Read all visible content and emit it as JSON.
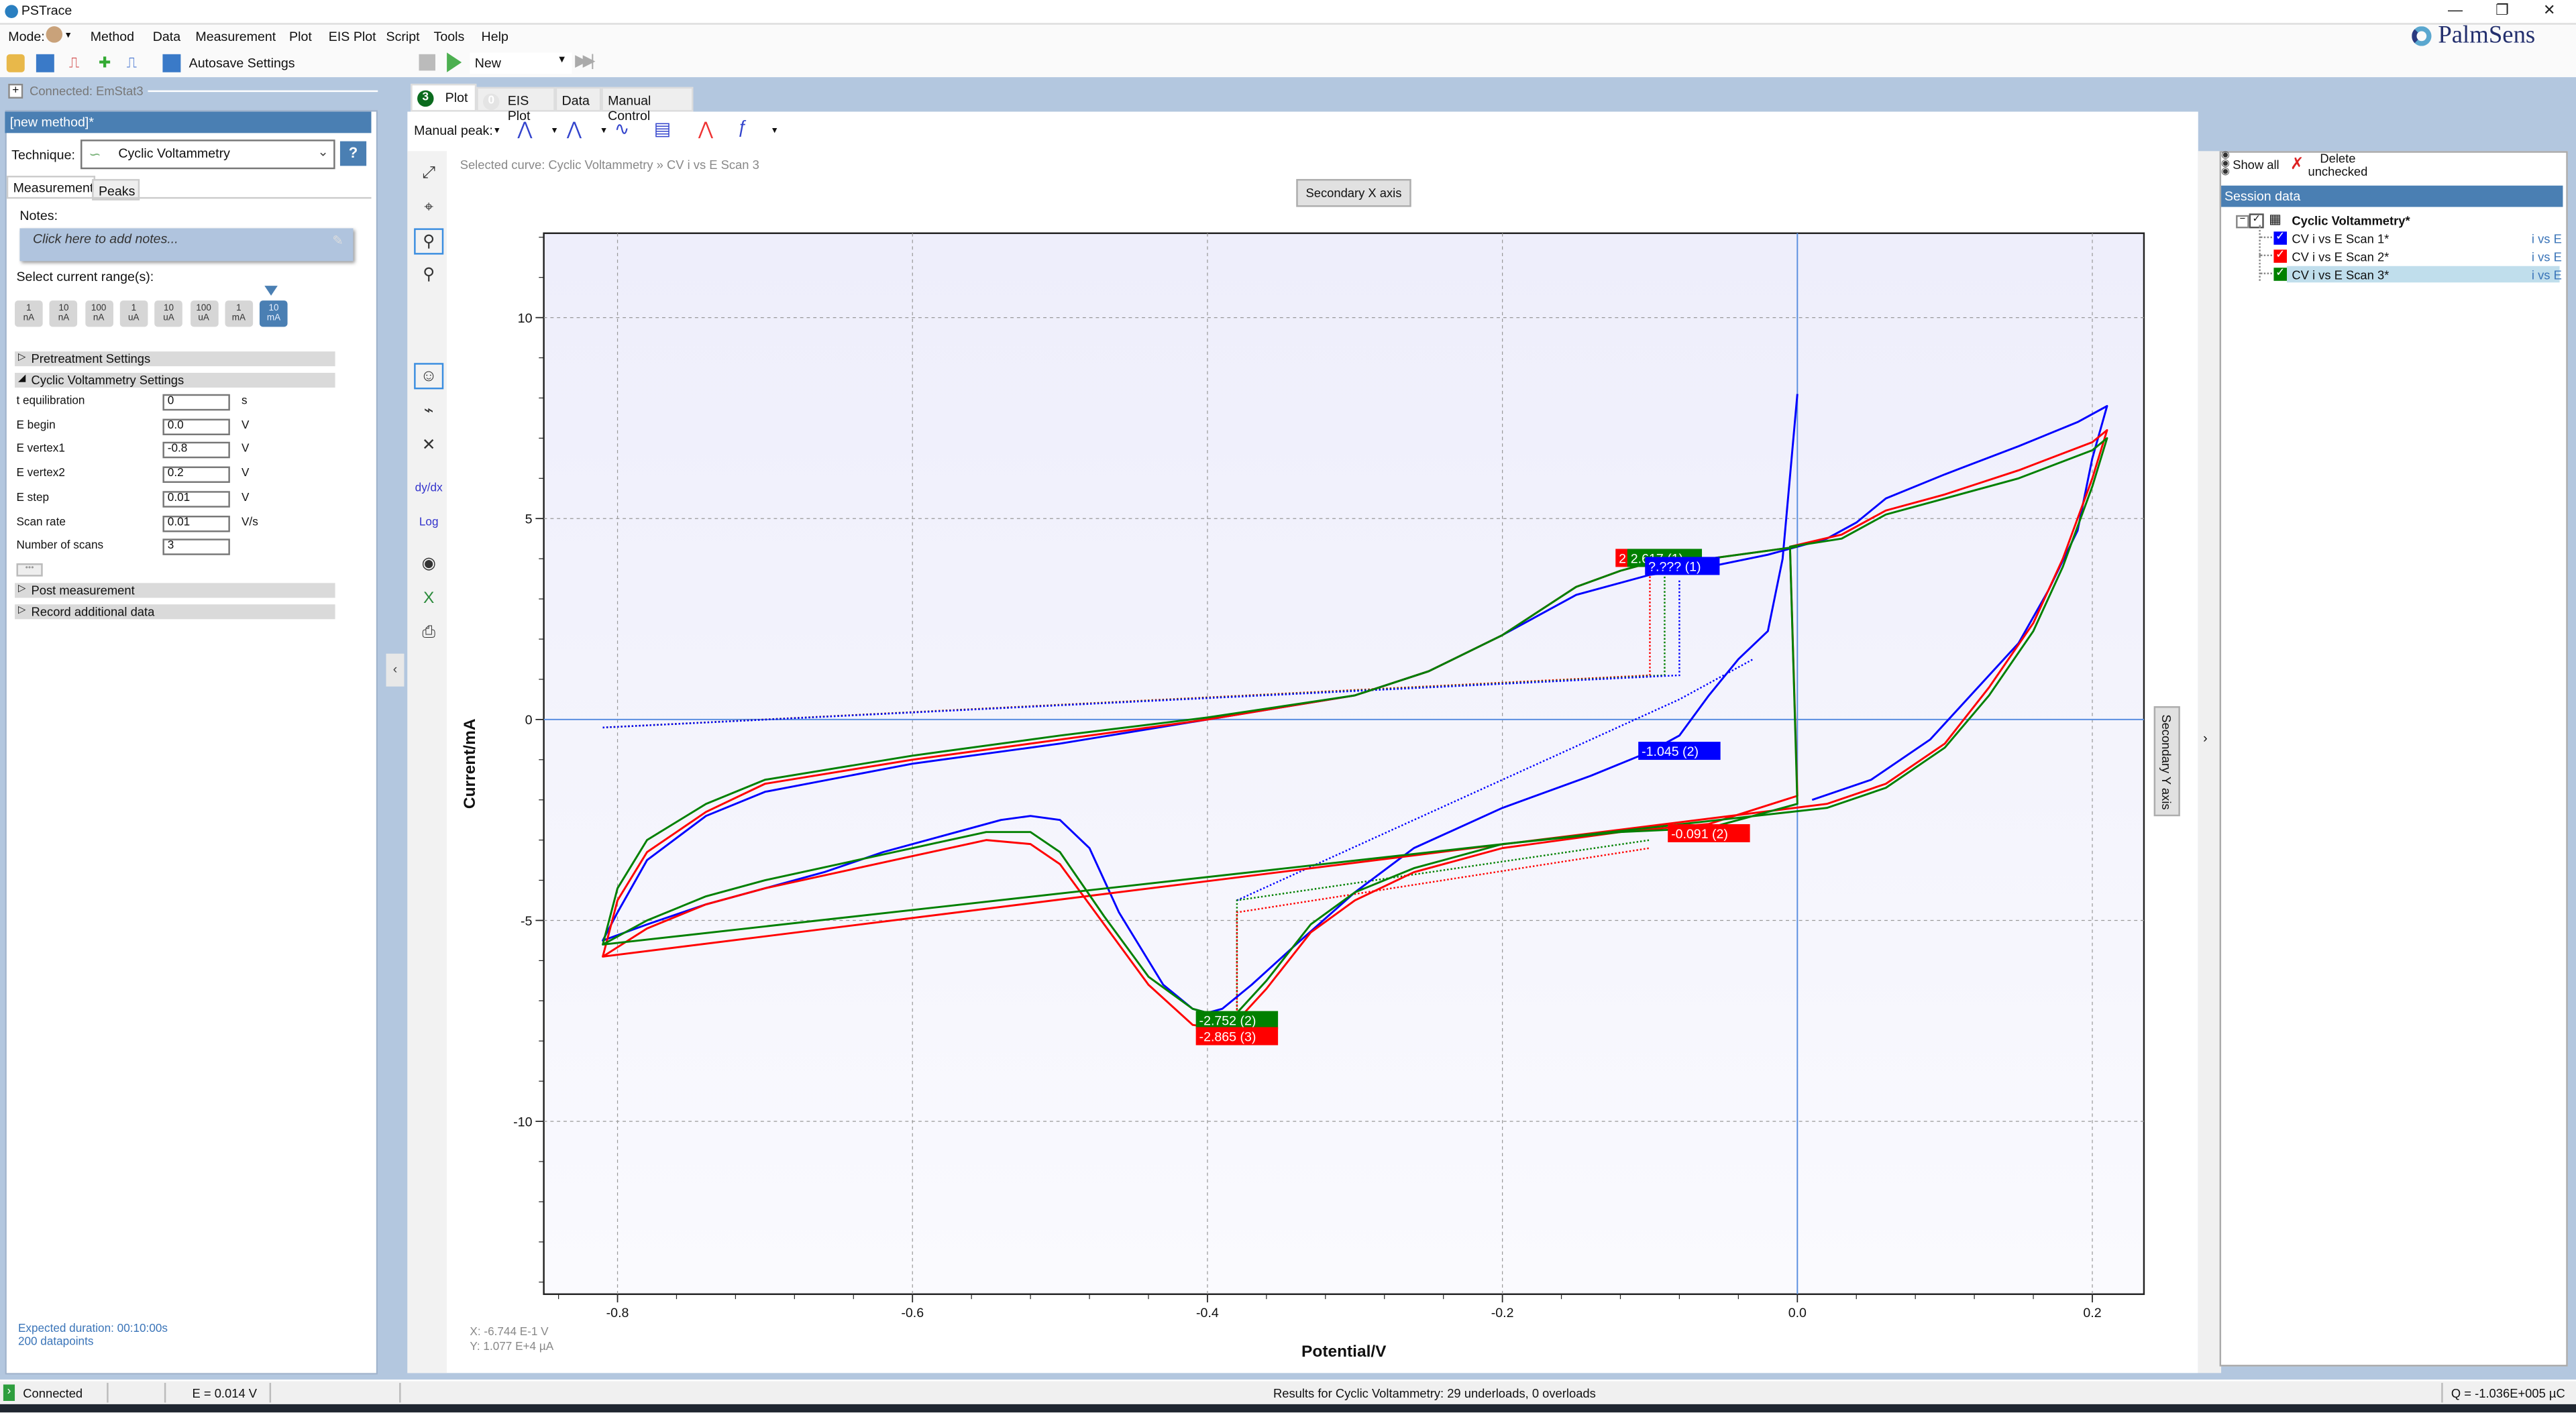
{
  "window": {
    "title": "PSTrace",
    "controls": [
      "minimize-icon",
      "restore-icon",
      "close-icon"
    ]
  },
  "brand": "PalmSens",
  "menu": {
    "mode_label": "Mode:",
    "items": [
      "Method",
      "Data",
      "Measurement",
      "Plot",
      "EIS Plot",
      "Script",
      "Tools",
      "Help"
    ]
  },
  "toolbar": {
    "autosave_label": "Autosave Settings",
    "run_selection": "New"
  },
  "connection": {
    "label": "Connected: EmStat3"
  },
  "method": {
    "title": "[new method]*",
    "technique_label": "Technique:",
    "technique_value": "Cyclic Voltammetry",
    "help_label": "?",
    "tabs": [
      "Measurement",
      "Peaks"
    ],
    "notes_label": "Notes:",
    "notes_placeholder": "Click here to add notes...",
    "current_range_label": "Select current range(s):",
    "current_ranges": [
      {
        "value": "1",
        "unit": "nA",
        "selected": false
      },
      {
        "value": "10",
        "unit": "nA",
        "selected": false
      },
      {
        "value": "100",
        "unit": "nA",
        "selected": false
      },
      {
        "value": "1",
        "unit": "uA",
        "selected": false
      },
      {
        "value": "10",
        "unit": "uA",
        "selected": false
      },
      {
        "value": "100",
        "unit": "uA",
        "selected": false
      },
      {
        "value": "1",
        "unit": "mA",
        "selected": false
      },
      {
        "value": "10",
        "unit": "mA",
        "selected": true
      }
    ],
    "sections": {
      "pretreatment": "Pretreatment Settings",
      "cv": "Cyclic Voltammetry Settings",
      "post": "Post measurement",
      "record": "Record additional data"
    },
    "params": [
      {
        "label": "t equilibration",
        "value": "0",
        "unit": "s"
      },
      {
        "label": "E begin",
        "value": "0.0",
        "unit": "V"
      },
      {
        "label": "E vertex1",
        "value": "-0.8",
        "unit": "V"
      },
      {
        "label": "E vertex2",
        "value": "0.2",
        "unit": "V"
      },
      {
        "label": "E step",
        "value": "0.01",
        "unit": "V"
      },
      {
        "label": "Scan rate",
        "value": "0.01",
        "unit": "V/s"
      },
      {
        "label": "Number of scans",
        "value": "3",
        "unit": ""
      }
    ],
    "more_label": "•••",
    "expected_duration": "Expected duration: 00:10:00s",
    "datapoints": "200 datapoints"
  },
  "center": {
    "tabs": [
      {
        "label": "Plot",
        "badge": "3",
        "active": true
      },
      {
        "label": "EIS Plot",
        "badge": "0",
        "active": false
      },
      {
        "label": "Data",
        "active": false
      },
      {
        "label": "Manual Control",
        "active": false
      }
    ],
    "manual_peak_label": "Manual peak:",
    "selected_curve": "Selected curve: Cyclic Voltammetry » CV i vs E Scan 3",
    "secondary_x_label": "Secondary X axis",
    "secondary_y_label": "Secondary Y axis",
    "cursor_x": "X: -6.744 E-1 V",
    "cursor_y": "Y: 1.077 E+4 µA"
  },
  "session": {
    "show_all": "Show all",
    "delete_unchecked": "Delete unchecked",
    "header": "Session data",
    "group": "Cyclic Voltammetry*",
    "items": [
      {
        "label": "CV i vs E Scan 1*",
        "type": "i vs E",
        "color": "#0000ff",
        "checked": true,
        "selected": false
      },
      {
        "label": "CV i vs E Scan 2*",
        "type": "i vs E",
        "color": "#ff0000",
        "checked": true,
        "selected": false
      },
      {
        "label": "CV i vs E Scan 3*",
        "type": "i vs E",
        "color": "#008000",
        "checked": true,
        "selected": true
      }
    ]
  },
  "status": {
    "connected": "Connected",
    "potential": "E = 0.014 V",
    "results": "Results for Cyclic Voltammetry: 29 underloads, 0 overloads",
    "charge": "Q = -1.036E+005 µC"
  },
  "chart_data": {
    "type": "line",
    "title": "",
    "xlabel": "Potential/V",
    "ylabel": "Current/mA",
    "xlim": [
      -0.85,
      0.235
    ],
    "ylim": [
      -14.3,
      12.1
    ],
    "xticks": [
      -0.8,
      -0.6,
      -0.4,
      -0.2,
      0.0,
      0.2
    ],
    "xtick_labels": [
      "-0.8",
      "-0.6",
      "-0.4",
      "-0.2",
      "0.0",
      "0.2"
    ],
    "yticks": [
      10,
      5,
      0,
      -5,
      -10
    ],
    "ytick_labels": [
      "10",
      "5",
      "0",
      "-5",
      "-10"
    ],
    "grid": true,
    "series": [
      {
        "name": "CV i vs E Scan 1",
        "color": "#0000ff",
        "x": [
          0.0,
          0.0,
          -0.01,
          -0.02,
          -0.04,
          -0.06,
          -0.08,
          -0.1,
          -0.14,
          -0.2,
          -0.26,
          -0.3,
          -0.34,
          -0.37,
          -0.39,
          -0.4,
          -0.41,
          -0.43,
          -0.46,
          -0.48,
          -0.5,
          -0.52,
          -0.54,
          -0.58,
          -0.62,
          -0.66,
          -0.7,
          -0.74,
          -0.78,
          -0.81,
          -0.8,
          -0.78,
          -0.74,
          -0.7,
          -0.6,
          -0.5,
          -0.4,
          -0.3,
          -0.25,
          -0.2,
          -0.15,
          -0.12,
          -0.1,
          -0.06,
          -0.02,
          0.0,
          0.02,
          0.04,
          0.06,
          0.1,
          0.15,
          0.19,
          0.21,
          0.2,
          0.19,
          0.17,
          0.15,
          0.12,
          0.09,
          0.05,
          0.01
        ],
        "y": [
          8.1,
          8.1,
          4.0,
          2.2,
          1.5,
          0.6,
          -0.4,
          -0.8,
          -1.4,
          -2.2,
          -3.2,
          -4.3,
          -5.6,
          -6.6,
          -7.2,
          -7.3,
          -7.2,
          -6.6,
          -4.8,
          -3.2,
          -2.5,
          -2.4,
          -2.5,
          -2.9,
          -3.3,
          -3.8,
          -4.2,
          -4.6,
          -5.1,
          -5.5,
          -4.8,
          -3.5,
          -2.4,
          -1.8,
          -1.1,
          -0.6,
          0.0,
          0.6,
          1.2,
          2.1,
          3.1,
          3.4,
          3.6,
          3.8,
          4.1,
          4.3,
          4.5,
          4.9,
          5.5,
          6.1,
          6.8,
          7.4,
          7.8,
          6.5,
          4.7,
          3.2,
          1.9,
          0.7,
          -0.5,
          -1.5,
          -2.0
        ]
      },
      {
        "name": "CV i vs E Scan 2",
        "color": "#ff0000",
        "x": [
          -0.81,
          -0.78,
          -0.74,
          -0.7,
          -0.6,
          -0.55,
          -0.52,
          -0.5,
          -0.47,
          -0.44,
          -0.41,
          -0.39,
          -0.38,
          -0.36,
          -0.33,
          -0.3,
          -0.26,
          -0.2,
          -0.12,
          -0.06,
          0.0,
          -0.005,
          0.03,
          0.06,
          0.1,
          0.15,
          0.2,
          0.21,
          0.2,
          0.18,
          0.16,
          0.13,
          0.1,
          0.06,
          0.02,
          -0.81,
          -0.8,
          -0.78,
          -0.74,
          -0.7,
          -0.6,
          -0.5,
          -0.4,
          -0.3,
          -0.25,
          -0.2,
          -0.15,
          -0.12,
          -0.1,
          -0.06,
          -0.02,
          0.0
        ],
        "y": [
          -5.9,
          -5.2,
          -4.6,
          -4.2,
          -3.4,
          -3.0,
          -3.1,
          -3.6,
          -5.1,
          -6.6,
          -7.6,
          -7.7,
          -7.5,
          -6.7,
          -5.3,
          -4.5,
          -3.8,
          -3.2,
          -2.8,
          -2.6,
          -1.9,
          4.3,
          4.6,
          5.2,
          5.6,
          6.2,
          6.9,
          7.2,
          6.0,
          4.0,
          2.4,
          0.8,
          -0.6,
          -1.6,
          -2.1,
          -5.9,
          -4.5,
          -3.3,
          -2.3,
          -1.6,
          -1.0,
          -0.5,
          0.0,
          0.6,
          1.2,
          2.1,
          3.3,
          3.7,
          3.9,
          4.0,
          4.2,
          4.3
        ]
      },
      {
        "name": "CV i vs E Scan 3",
        "color": "#008000",
        "x": [
          -0.81,
          -0.78,
          -0.74,
          -0.7,
          -0.6,
          -0.55,
          -0.52,
          -0.5,
          -0.47,
          -0.44,
          -0.41,
          -0.39,
          -0.38,
          -0.36,
          -0.33,
          -0.3,
          -0.26,
          -0.2,
          -0.12,
          -0.06,
          0.0,
          -0.005,
          0.03,
          0.06,
          0.1,
          0.15,
          0.2,
          0.21,
          0.2,
          0.18,
          0.16,
          0.13,
          0.1,
          0.06,
          0.02,
          -0.81,
          -0.8,
          -0.78,
          -0.74,
          -0.7,
          -0.6,
          -0.5,
          -0.4,
          -0.3,
          -0.25,
          -0.2,
          -0.15,
          -0.12,
          -0.1,
          -0.06,
          -0.02,
          0.0
        ],
        "y": [
          -5.6,
          -5.0,
          -4.4,
          -4.0,
          -3.2,
          -2.8,
          -2.8,
          -3.3,
          -4.9,
          -6.4,
          -7.2,
          -7.4,
          -7.3,
          -6.5,
          -5.1,
          -4.3,
          -3.7,
          -3.1,
          -2.8,
          -2.7,
          -2.1,
          4.3,
          4.5,
          5.1,
          5.5,
          6.0,
          6.7,
          7.0,
          5.8,
          3.8,
          2.2,
          0.6,
          -0.7,
          -1.7,
          -2.2,
          -5.6,
          -4.2,
          -3.0,
          -2.1,
          -1.5,
          -0.9,
          -0.4,
          0.05,
          0.6,
          1.2,
          2.1,
          3.3,
          3.7,
          3.9,
          4.0,
          4.2,
          4.3
        ]
      }
    ],
    "peaks": [
      {
        "label": "2.6?? (1)",
        "color": "#ff0000",
        "x": -0.098,
        "y": 4.0
      },
      {
        "label": "2.617 (1)",
        "color": "#008000",
        "x": -0.09,
        "y": 4.0
      },
      {
        "label": "?.??? (1)",
        "color": "#0000ff",
        "x": -0.078,
        "y": 3.8
      },
      {
        "label": "-1.045 (2)",
        "color": "#0000ff",
        "x": -0.08,
        "y": -0.8
      },
      {
        "label": "-0.091 (2)",
        "color": "#ff0000",
        "x": -0.06,
        "y": -2.85
      },
      {
        "label": "-2.752 (2)",
        "color": "#008000",
        "x": -0.38,
        "y": -7.5
      },
      {
        "label": "-2.865 (3)",
        "color": "#ff0000",
        "x": -0.38,
        "y": -7.9
      }
    ],
    "baselines": [
      {
        "color": "#ff0000",
        "x": [
          -0.81,
          -0.1,
          -0.1
        ],
        "y": [
          -0.2,
          1.1,
          3.6
        ]
      },
      {
        "color": "#008000",
        "x": [
          -0.81,
          -0.09,
          -0.09
        ],
        "y": [
          -0.2,
          1.1,
          3.7
        ]
      },
      {
        "color": "#0000ff",
        "x": [
          -0.81,
          -0.08,
          -0.08
        ],
        "y": [
          -0.2,
          1.1,
          3.5
        ]
      },
      {
        "color": "#0000ff",
        "x": [
          -0.38,
          -0.08,
          -0.08,
          -0.03
        ],
        "y": [
          -4.5,
          0.5,
          0.5,
          1.5
        ]
      },
      {
        "color": "#008000",
        "x": [
          -0.38,
          -0.38,
          -0.1
        ],
        "y": [
          -7.4,
          -4.5,
          -3.0
        ]
      },
      {
        "color": "#ff0000",
        "x": [
          -0.38,
          -0.38,
          -0.1
        ],
        "y": [
          -7.6,
          -4.8,
          -3.2
        ]
      }
    ],
    "legend": "none"
  }
}
